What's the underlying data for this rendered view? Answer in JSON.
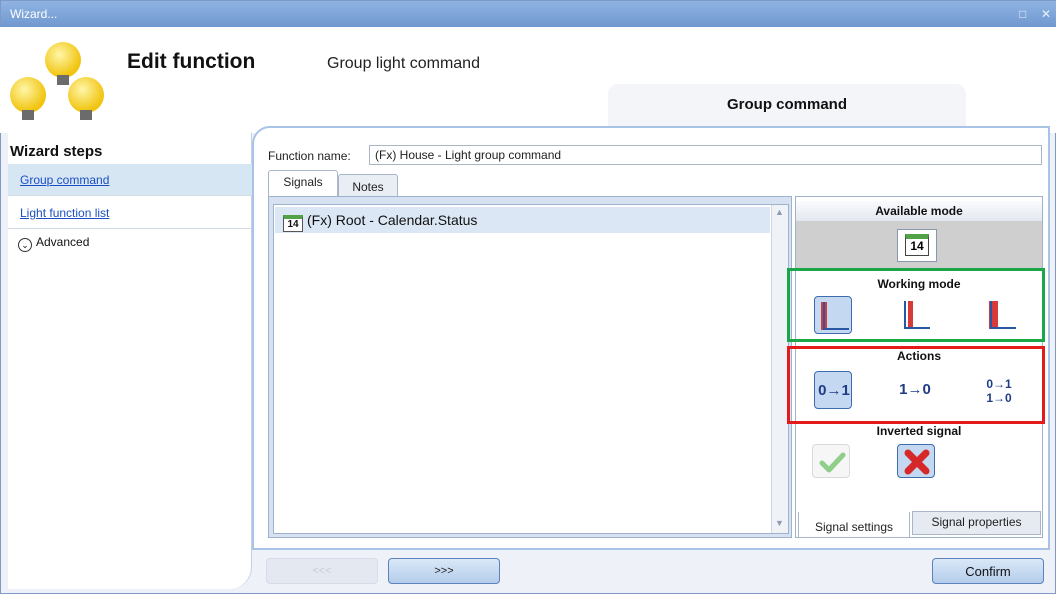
{
  "window": {
    "title": "Wizard...",
    "restore_glyph": "□",
    "close_glyph": "✕"
  },
  "header": {
    "title": "Edit function",
    "subtitle": "Group light command",
    "step_tab": "Group command"
  },
  "sidebar": {
    "title": "Wizard steps",
    "items": [
      {
        "label": "Group command",
        "selected": true
      },
      {
        "label": "Light function list",
        "selected": false
      }
    ],
    "advanced": {
      "label": "Advanced",
      "icon": "chevron-down-icon"
    }
  },
  "form": {
    "function_name_label": "Function name:",
    "function_name_value": "(Fx) House - Light group command"
  },
  "tabs": [
    {
      "label": "Signals",
      "active": true
    },
    {
      "label": "Notes",
      "active": false
    }
  ],
  "signals": [
    {
      "icon": "calendar-icon",
      "icon_text": "14",
      "label": "(Fx) Root - Calendar.Status"
    }
  ],
  "signal_panel": {
    "available_mode": {
      "title": "Available mode",
      "icon": "calendar-icon",
      "icon_text": "14"
    },
    "working_mode": {
      "title": "Working mode",
      "options": [
        "rising-edge-icon",
        "falling-edge-icon",
        "pulse-icon"
      ],
      "selected": 0
    },
    "actions": {
      "title": "Actions",
      "options": [
        {
          "line1": "0→1",
          "line2": ""
        },
        {
          "line1": "1→0",
          "line2": ""
        },
        {
          "line1": "0→1",
          "line2": "1→0"
        }
      ],
      "selected": 0
    },
    "inverted_signal": {
      "title": "Inverted signal",
      "yes_icon": "checkmark-icon",
      "no_icon": "cross-icon",
      "selected": "no"
    },
    "bottom_tabs": [
      {
        "label": "Signal settings",
        "active": true
      },
      {
        "label": "Signal properties",
        "active": false
      }
    ]
  },
  "footer": {
    "back_label": "<<<",
    "next_label": ">>>",
    "confirm_label": "Confirm"
  },
  "colors": {
    "highlight_green": "#1ca64a",
    "highlight_red": "#e31b1b",
    "selected_bg": "#c4d9f1",
    "accent_blue": "#1c4fc4"
  }
}
